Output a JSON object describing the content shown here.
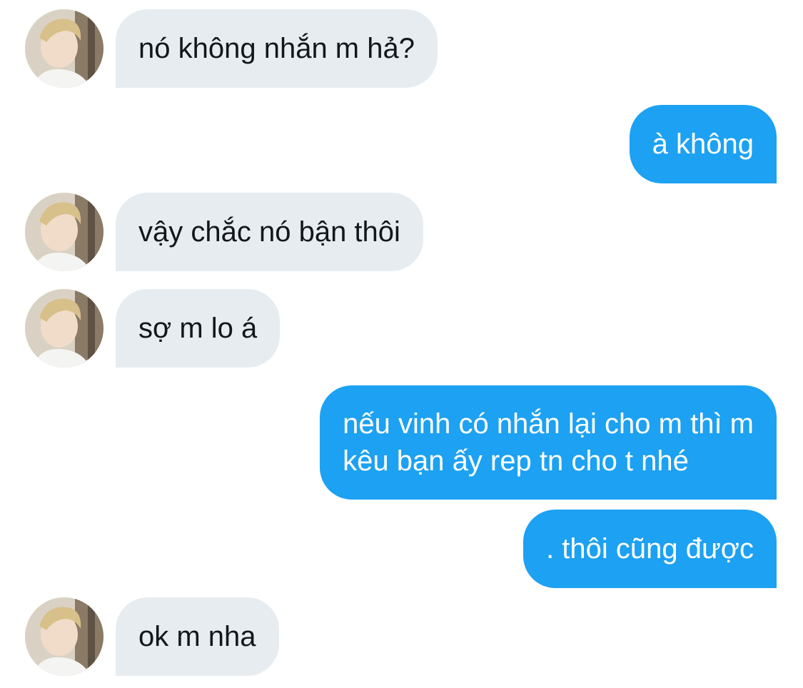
{
  "colors": {
    "incoming_bubble": "#e6ecf0",
    "outgoing_bubble": "#1da1f2",
    "incoming_text": "#14171a",
    "outgoing_text": "#ffffff"
  },
  "messages": [
    {
      "direction": "incoming",
      "avatar_icon": "user-avatar",
      "lines": [
        "nó không nhắn m hả?"
      ]
    },
    {
      "direction": "outgoing",
      "lines": [
        "à không"
      ]
    },
    {
      "direction": "incoming",
      "avatar_icon": "user-avatar",
      "lines": [
        "vậy chắc nó bận thôi"
      ]
    },
    {
      "direction": "incoming",
      "avatar_icon": "user-avatar",
      "lines": [
        "sợ m lo á"
      ]
    },
    {
      "direction": "outgoing",
      "lines": [
        "nếu vinh có nhắn lại cho m thì m",
        "kêu bạn ấy rep tn cho t nhé"
      ]
    },
    {
      "direction": "outgoing",
      "lines": [
        ". thôi cũng được"
      ]
    },
    {
      "direction": "incoming",
      "avatar_icon": "user-avatar",
      "lines": [
        "ok m nha"
      ]
    }
  ]
}
